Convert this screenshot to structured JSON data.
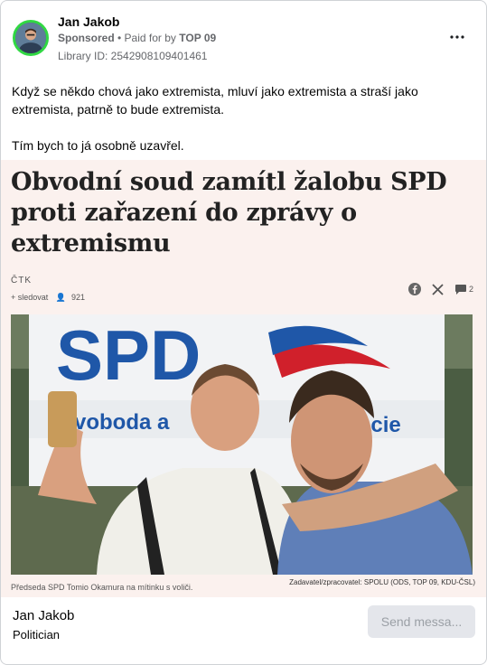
{
  "header": {
    "page_name": "Jan Jakob",
    "sponsored": "Sponsored",
    "separator": " • ",
    "paid_prefix": "Paid for by ",
    "paid_by": "TOP 09",
    "library_id": "Library ID: 2542908109401461",
    "more_icon": "more-horizontal-icon"
  },
  "ad_text": {
    "paragraph_1": "Když se někdo chová jako extremista, mluví jako extremista a straší jako extremista, patrně to bude extremista.",
    "paragraph_2": "Tím bych to já osobně uzavřel."
  },
  "creative": {
    "headline": "Obvodní soud zamítl žalobu SPD proti zařazení do zprávy o extremismu",
    "source": "ČTK",
    "follow_label": "+ sledovat",
    "followers": "921",
    "comment_count": "2",
    "photo_sign_text": "SPD",
    "photo_banner_text": "voboda a",
    "photo_banner_text_2": "acie",
    "caption": "Předseda SPD Tomio Okamura na mítinku s voliči.",
    "credit": "Zadavatel/zpracovatel: SPOLU (ODS, TOP 09, KDU-ČSL)"
  },
  "footer": {
    "name": "Jan Jakob",
    "category": "Politician",
    "send_button": "Send messa..."
  },
  "colors": {
    "avatar_ring": "#31d843",
    "creative_bg": "#fbf1ee",
    "button_bg": "#e4e6eb",
    "spd_blue": "#1f57a8",
    "spd_red": "#d0202b"
  }
}
